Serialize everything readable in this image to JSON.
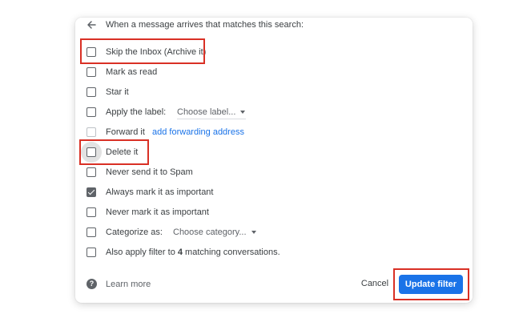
{
  "header": {
    "text": "When a message arrives that matches this search:"
  },
  "actions": [
    {
      "label": "Skip the Inbox (Archive it)",
      "checked": false
    },
    {
      "label": "Mark as read",
      "checked": false
    },
    {
      "label": "Star it",
      "checked": false
    },
    {
      "label": "Apply the label:",
      "checked": false,
      "dropdown": "Choose label..."
    },
    {
      "label": "Forward it",
      "checked": false,
      "link": "add forwarding address"
    },
    {
      "label": "Delete it",
      "checked": false
    },
    {
      "label": "Never send it to Spam",
      "checked": false
    },
    {
      "label": "Always mark it as important",
      "checked": true
    },
    {
      "label": "Never mark it as important",
      "checked": false
    },
    {
      "label": "Categorize as:",
      "checked": false,
      "dropdown": "Choose category..."
    },
    {
      "label_prefix": "Also apply filter to ",
      "label_count": "4",
      "label_suffix": " matching conversations.",
      "checked": false
    }
  ],
  "footer": {
    "help_glyph": "?",
    "learn_more": "Learn more",
    "cancel": "Cancel",
    "update": "Update filter"
  },
  "colors": {
    "accent": "#1a73e8",
    "highlight": "#d93025"
  }
}
